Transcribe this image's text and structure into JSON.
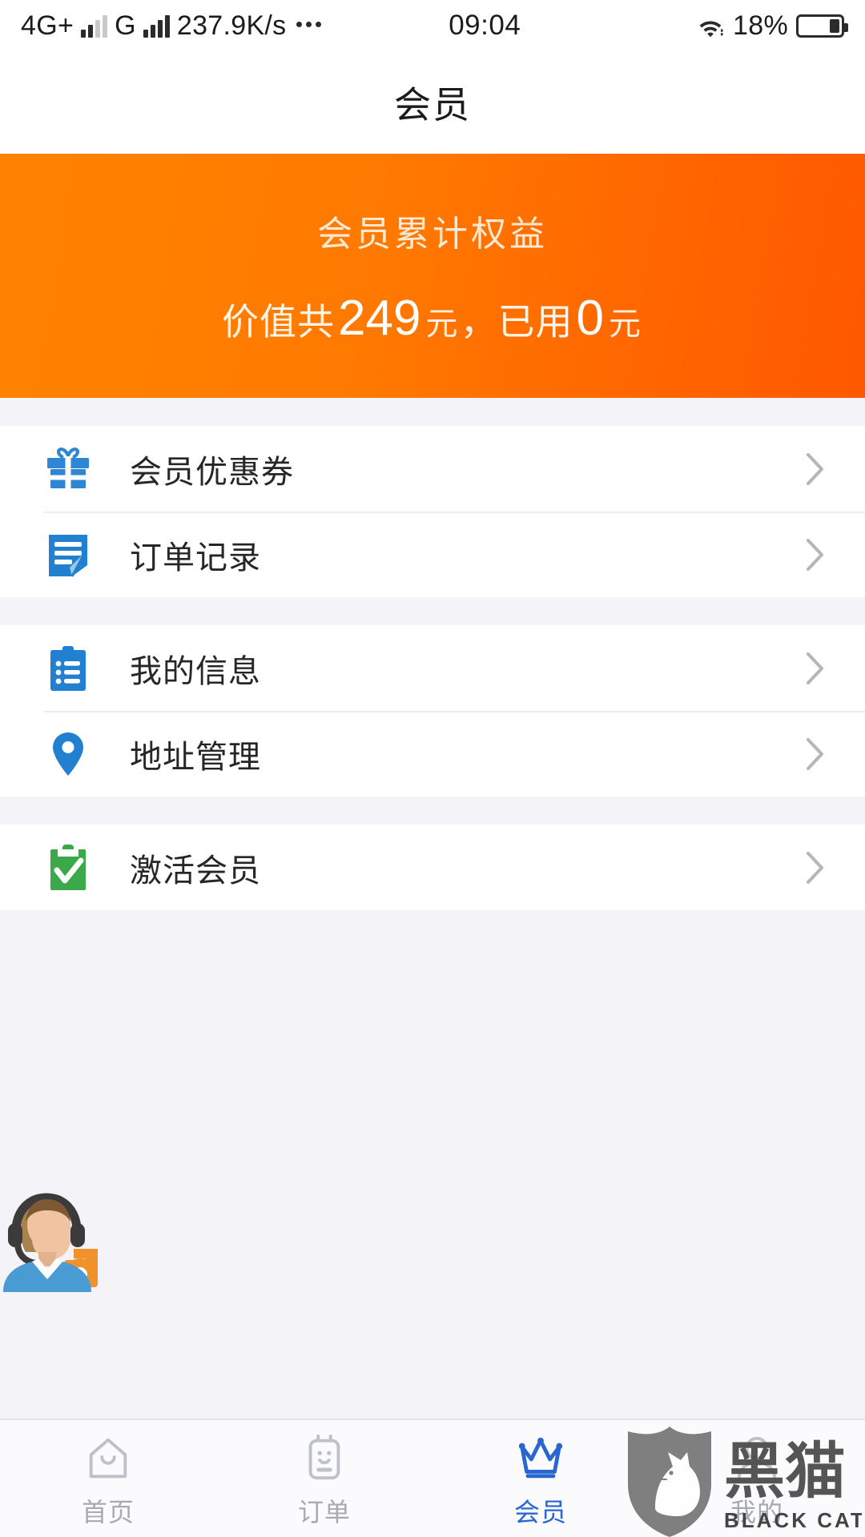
{
  "statusbar": {
    "network_type": "4G+",
    "second_network": "G",
    "speed": "237.9K/s",
    "overflow_dots": "•••",
    "time": "09:04",
    "battery_percent": "18%",
    "wifi_icon": "wifi-icon",
    "battery_icon": "battery-icon",
    "signal_icon": "signal-bars-icon"
  },
  "header": {
    "title": "会员"
  },
  "banner": {
    "title": "会员累计权益",
    "prefix": "价值共",
    "total_value": "249",
    "unit1": "元",
    "separator": "，",
    "used_prefix": "已用",
    "used_value": "0",
    "unit2": "元",
    "color_start": "#ff8300",
    "color_end": "#ff5800"
  },
  "menu_groups": [
    {
      "items": [
        {
          "label": "会员优惠券",
          "icon": "gift-icon",
          "icon_color": "#2e86d4"
        },
        {
          "label": "订单记录",
          "icon": "document-edit-icon",
          "icon_color": "#2180cf"
        }
      ]
    },
    {
      "items": [
        {
          "label": "我的信息",
          "icon": "clipboard-list-icon",
          "icon_color": "#2180cf"
        },
        {
          "label": "地址管理",
          "icon": "location-pin-icon",
          "icon_color": "#2180cf"
        }
      ]
    },
    {
      "items": [
        {
          "label": "激活会员",
          "icon": "clipboard-check-icon",
          "icon_color": "#3ba84a"
        }
      ]
    }
  ],
  "chevron_icon": "chevron-right-icon",
  "service_fab": {
    "icon": "customer-service-agent-icon",
    "jacket_color": "#4a9ad4",
    "gear_color": "#f0922b"
  },
  "tabbar": {
    "active_color": "#2a66cf",
    "inactive_color": "#a8aab3",
    "tabs": [
      {
        "label": "首页",
        "icon": "home-icon",
        "active": false
      },
      {
        "label": "订单",
        "icon": "order-clipboard-icon",
        "active": false
      },
      {
        "label": "会员",
        "icon": "crown-icon",
        "active": true
      },
      {
        "label": "我的",
        "icon": "person-icon",
        "active": false
      }
    ]
  },
  "watermark": {
    "title_cn": "黑猫",
    "title_en": "BLACK CAT",
    "icon": "black-cat-shield-icon"
  }
}
